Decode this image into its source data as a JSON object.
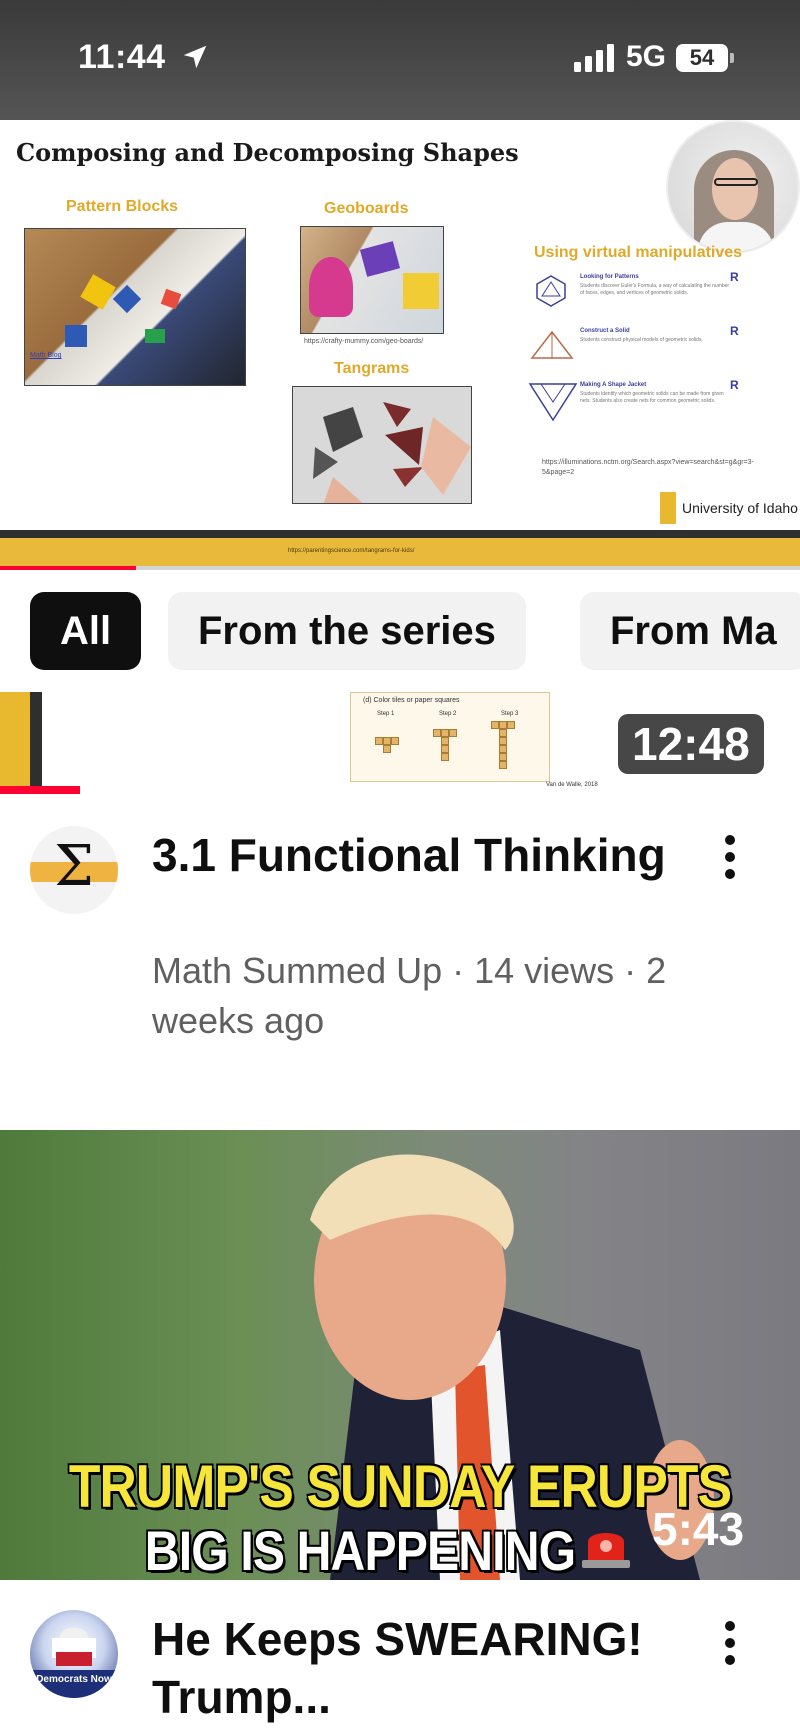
{
  "status_bar": {
    "time": "11:44",
    "network": "5G",
    "battery": "54"
  },
  "player_slide": {
    "title": "Composing and Decomposing Shapes",
    "sections": {
      "pattern_blocks": "Pattern Blocks",
      "geoboards": "Geoboards",
      "tangrams": "Tangrams",
      "virtual": "Using virtual manipulatives"
    },
    "captions": {
      "math_blog": "Math Blog",
      "geoboards_url": "https://crafty-mummy.com/geo-boards/",
      "tangrams_url": "https://parentingscience.com/tangrams-for-kids/",
      "illuminations_url": "https://illuminations.nctm.org/Search.aspx?view=search&st=g&gr=3-5&page=2"
    },
    "virtual_items": [
      {
        "title": "Looking for Patterns",
        "desc": "Students discover Euler's Formula, a way of calculating the number of faces, edges, and vertices of geometric solids."
      },
      {
        "title": "Construct a Solid",
        "desc": "Students construct physical models of geometric solids."
      },
      {
        "title": "Making A Shape Jacket",
        "desc": "Students identify which geometric solids can be made from given nets. Students also create nets for common geometric solids."
      }
    ],
    "university": "University of Idaho",
    "progress_percent": 17
  },
  "chips": [
    {
      "label": "All",
      "active": true
    },
    {
      "label": "From the series",
      "active": false
    },
    {
      "label": "From Ma",
      "active": false
    }
  ],
  "mini_preview": {
    "caption": "(d) Color tiles or paper squares",
    "steps": [
      "Step 1",
      "Step 2",
      "Step 3"
    ],
    "credit": "Van de Walle, 2018",
    "progress_percent": 10
  },
  "videos": [
    {
      "duration": "12:48",
      "title": "3.1 Functional Thinking",
      "channel_meta": "Math Summed Up · 14 views · 2 weeks ago",
      "avatar_icon": "sigma-icon"
    },
    {
      "duration": "5:43",
      "thumbnail_text_1": "TRUMP'S SUNDAY ERUPTS",
      "thumbnail_text_2": "BIG IS HAPPENING",
      "title": "He Keeps SWEARING! Trump...",
      "avatar_text": "Democrats Now",
      "avatar_icon": "donkey-capitol-icon"
    }
  ],
  "colors": {
    "accent_red": "#ff0033",
    "idaho_gold": "#e8b82f",
    "text_primary": "#0f0f0f",
    "text_secondary": "#606060"
  }
}
